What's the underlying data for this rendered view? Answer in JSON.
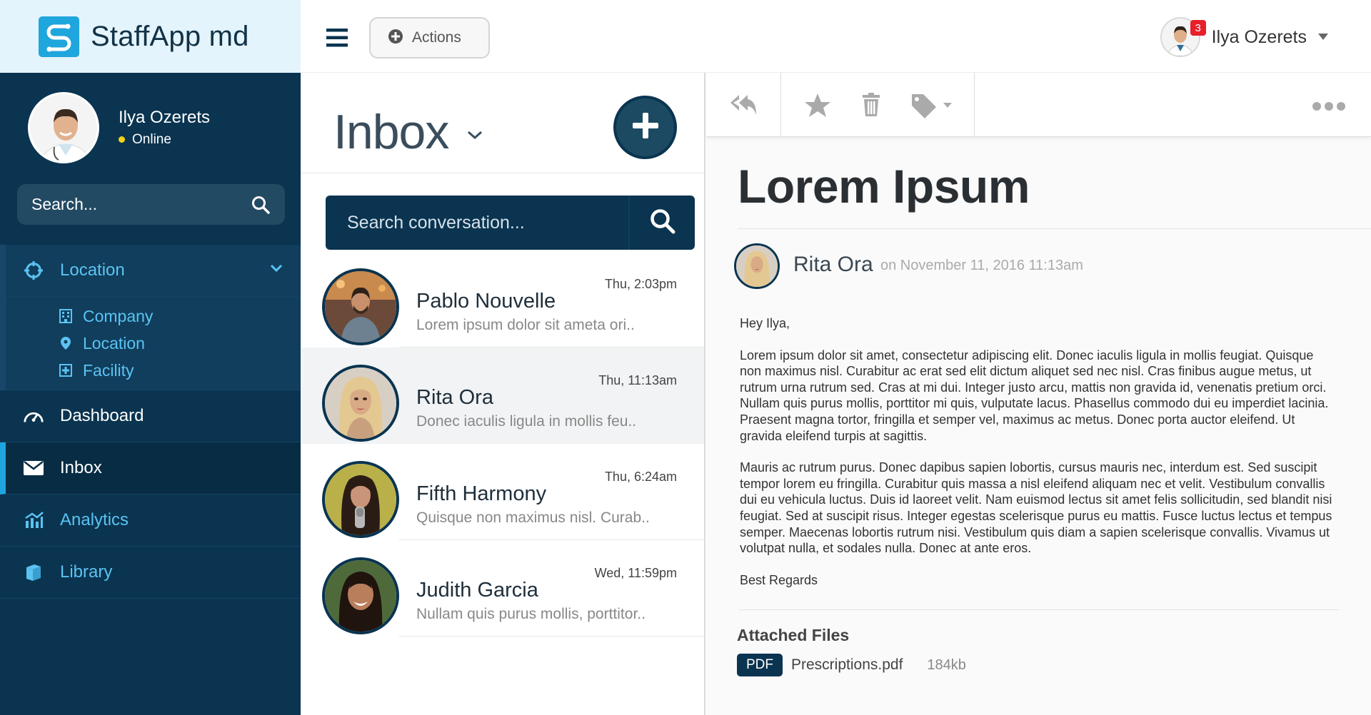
{
  "brand": {
    "name": "StaffApp md",
    "accent": "#1fa6dc"
  },
  "profile": {
    "name": "Ilya Ozerets",
    "status": "Online"
  },
  "sidebar_search": {
    "placeholder": "Search..."
  },
  "nav": {
    "location": {
      "label": "Location",
      "icon": "crosshair-icon"
    },
    "sub": [
      {
        "label": "Company",
        "icon": "building-icon"
      },
      {
        "label": "Location",
        "icon": "map-pin-icon"
      },
      {
        "label": "Facility",
        "icon": "hospital-icon"
      }
    ],
    "dashboard": {
      "label": "Dashboard",
      "icon": "speedometer-icon"
    },
    "inbox": {
      "label": "Inbox",
      "icon": "envelope-icon"
    },
    "analytics": {
      "label": "Analytics",
      "icon": "chart-icon"
    },
    "library": {
      "label": "Library",
      "icon": "books-icon"
    }
  },
  "topbar": {
    "actions_label": "Actions",
    "user_name": "Ilya Ozerets",
    "notifications": "3"
  },
  "inbox": {
    "title": "Inbox",
    "search_placeholder": "Search conversation...",
    "conversations": [
      {
        "name": "Pablo Nouvelle",
        "preview": "Lorem ipsum dolor sit ameta ori..",
        "time": "Thu, 2:03pm"
      },
      {
        "name": "Rita Ora",
        "preview": "Donec iaculis ligula in mollis feu..",
        "time": "Thu, 11:13am"
      },
      {
        "name": "Fifth Harmony",
        "preview": "Quisque non maximus nisl. Curab..",
        "time": "Thu, 6:24am"
      },
      {
        "name": "Judith Garcia",
        "preview": "Nullam quis purus mollis, porttitor..",
        "time": "Wed, 11:59pm"
      }
    ]
  },
  "message": {
    "subject": "Lorem Ipsum",
    "sender": "Rita Ora",
    "date": "on November 11, 2016 11:13am",
    "greeting": "Hey Ilya,",
    "paragraph1": "Lorem ipsum dolor sit amet, consectetur adipiscing elit. Donec iaculis ligula in mollis feugiat. Quisque non maximus nisl. Curabitur ac erat sed elit dictum aliquet sed nec nisl. Cras finibus augue metus, ut rutrum urna rutrum sed. Cras at mi dui. Integer justo arcu, mattis non gravida id, venenatis pretium orci. Nullam quis purus mollis, porttitor mi quis, vulputate lacus. Phasellus commodo dui eu imperdiet lacinia. Praesent magna tortor, fringilla et semper vel, maximus ac metus. Donec porta auctor eleifend. Ut gravida eleifend turpis at sagittis.",
    "paragraph2": "Mauris ac rutrum purus. Donec dapibus sapien lobortis, cursus mauris nec, interdum est. Sed suscipit tempor lorem eu fringilla. Curabitur quis massa a nisl eleifend aliquam nec et velit. Vestibulum convallis dui eu vehicula luctus. Duis id laoreet velit. Nam euismod lectus sit amet felis sollicitudin, sed blandit nisi feugiat. Sed at suscipit risus. Integer egestas scelerisque purus eu mattis. Fusce luctus lectus et tempus semper. Maecenas lobortis rutrum nisi. Vestibulum quis diam a sapien scelerisque convallis. Vivamus ut volutpat nulla, et sodales nulla. Donec at ante eros.",
    "signoff": "Best Regards",
    "attachments_title": "Attached Files",
    "attachment": {
      "type": "PDF",
      "name": "Prescriptions.pdf",
      "size": "184kb"
    }
  }
}
